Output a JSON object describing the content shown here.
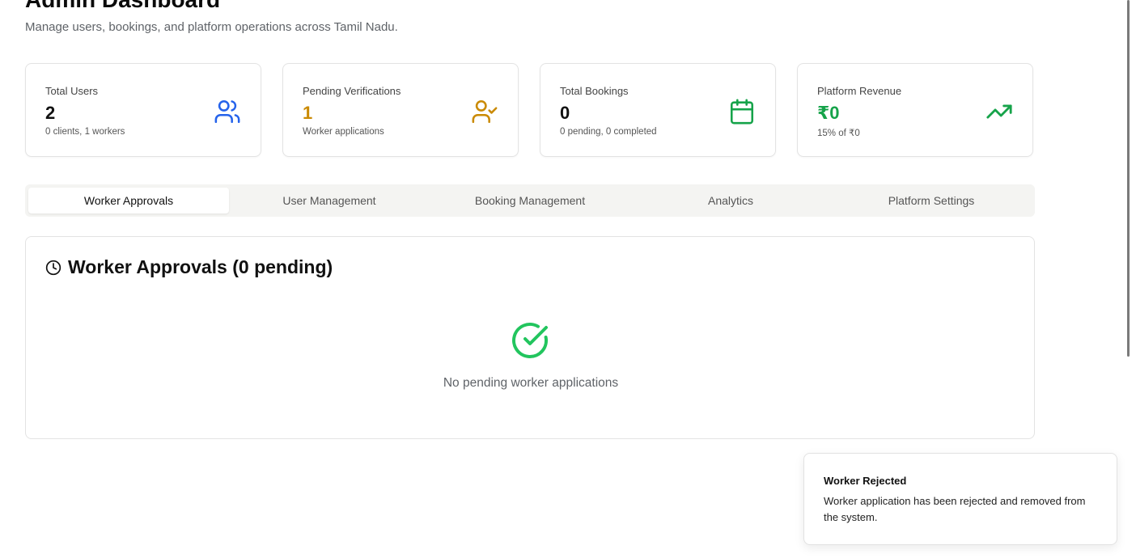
{
  "header": {
    "title": "Admin Dashboard",
    "subtitle": "Manage users, bookings, and platform operations across Tamil Nadu."
  },
  "stats": [
    {
      "label": "Total Users",
      "value": "2",
      "sub": "0 clients, 1 workers",
      "icon": "users-icon",
      "value_color": "#111111",
      "icon_color": "#2563eb"
    },
    {
      "label": "Pending Verifications",
      "value": "1",
      "sub": "Worker applications",
      "icon": "user-check-icon",
      "value_color": "#ca8a04",
      "icon_color": "#ca8a04"
    },
    {
      "label": "Total Bookings",
      "value": "0",
      "sub": "0 pending, 0 completed",
      "icon": "calendar-icon",
      "value_color": "#111111",
      "icon_color": "#16a34a"
    },
    {
      "label": "Platform Revenue",
      "value": "₹0",
      "sub": "15% of ₹0",
      "icon": "trending-up-icon",
      "value_color": "#16a34a",
      "icon_color": "#16a34a"
    }
  ],
  "tabs": [
    {
      "label": "Worker Approvals",
      "active": true
    },
    {
      "label": "User Management",
      "active": false
    },
    {
      "label": "Booking Management",
      "active": false
    },
    {
      "label": "Analytics",
      "active": false
    },
    {
      "label": "Platform Settings",
      "active": false
    }
  ],
  "panel": {
    "title": "Worker Approvals (0 pending)",
    "icon": "clock-icon",
    "empty_icon": "check-circle-icon",
    "empty_text": "No pending worker applications",
    "empty_icon_color": "#22c55e"
  },
  "toast": {
    "title": "Worker Rejected",
    "description": "Worker application has been rejected and removed from the system."
  }
}
